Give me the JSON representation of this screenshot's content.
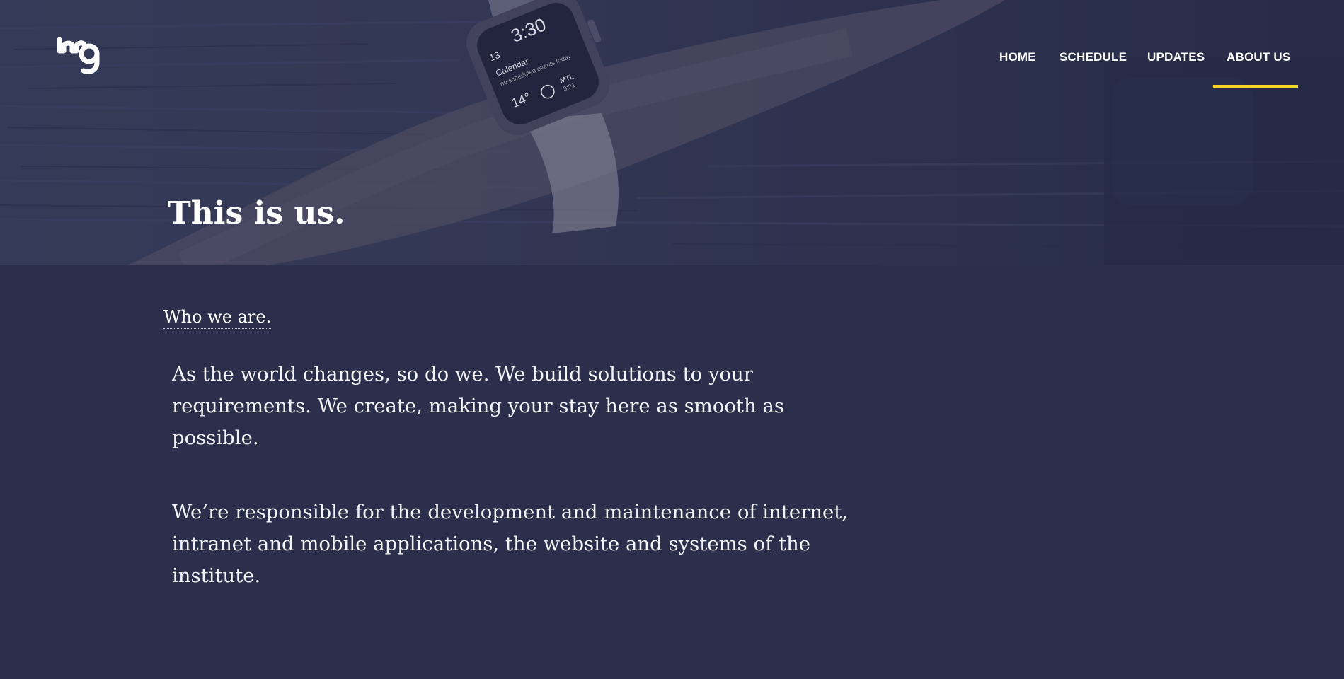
{
  "nav": {
    "items": [
      {
        "label": "HOME"
      },
      {
        "label": "SCHEDULE"
      },
      {
        "label": "UPDATES"
      },
      {
        "label": "ABOUT US",
        "active": true
      }
    ],
    "active_indicator_color": "#f2d624"
  },
  "hero": {
    "title": "This is us.",
    "watch_time": "3:30",
    "watch_date": "13",
    "watch_event_title": "Calendar",
    "watch_event_detail": "no scheduled events today",
    "watch_temp": "14°",
    "watch_city": "MTL",
    "watch_city_time": "3:21"
  },
  "about": {
    "section_label": "Who we are.",
    "paragraphs": [
      "As the world changes, so do we. We build solutions to your requirements. We create, making your stay here as smooth as possible.",
      "We’re responsible for the development and maintenance of internet, intranet and mobile applications, the website and systems of the institute."
    ]
  },
  "colors": {
    "page_background": "#2b2f4b",
    "text": "#ffffff",
    "accent": "#f2d624"
  }
}
